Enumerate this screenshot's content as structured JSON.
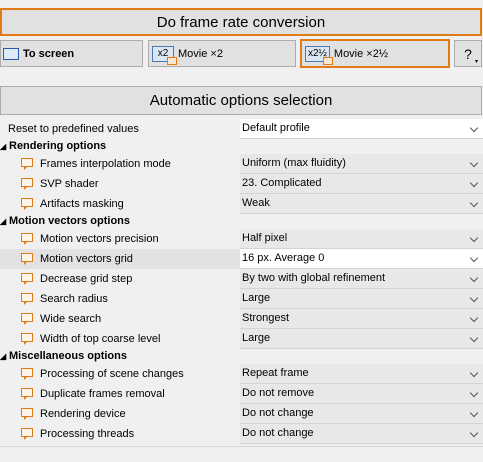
{
  "top_button": {
    "label": "Do frame rate conversion"
  },
  "toolbar": {
    "to_screen": "To screen",
    "movie2_icon": "x2",
    "movie2": "Movie ×2",
    "movie25_icon": "x2½",
    "movie25": "Movie ×2½",
    "help": "?",
    "help_dropdown": "▾"
  },
  "section_header": "Automatic options selection",
  "icons": {
    "collapse": "◢",
    "screen": "screen-icon",
    "movie": "movie-icon",
    "settings": "settings-icon"
  },
  "options": {
    "reset": {
      "label": "Reset to predefined values",
      "value": "Default profile"
    },
    "rendering": {
      "title": "Rendering options",
      "items": [
        {
          "label": "Frames interpolation mode",
          "value": "Uniform (max fluidity)"
        },
        {
          "label": "SVP shader",
          "value": "23. Complicated"
        },
        {
          "label": "Artifacts masking",
          "value": "Weak"
        }
      ]
    },
    "motion": {
      "title": "Motion vectors options",
      "items": [
        {
          "label": "Motion vectors precision",
          "value": "Half pixel"
        },
        {
          "label": "Motion vectors grid",
          "value": "16 px. Average 0"
        },
        {
          "label": "Decrease grid step",
          "value": "By two with global refinement"
        },
        {
          "label": "Search radius",
          "value": "Large"
        },
        {
          "label": "Wide search",
          "value": "Strongest"
        },
        {
          "label": "Width of top coarse level",
          "value": "Large"
        }
      ]
    },
    "misc": {
      "title": "Miscellaneous options",
      "items": [
        {
          "label": "Processing of scene changes",
          "value": "Repeat frame"
        },
        {
          "label": "Duplicate frames removal",
          "value": "Do not remove"
        },
        {
          "label": "Rendering device",
          "value": "Do not change"
        },
        {
          "label": "Processing threads",
          "value": "Do not change"
        }
      ]
    }
  },
  "colors": {
    "accent": "#e07b18",
    "button_bg": "#e1e1e1",
    "selected_row": "#e2e2e2",
    "icon_blue": "#2a5caa"
  }
}
